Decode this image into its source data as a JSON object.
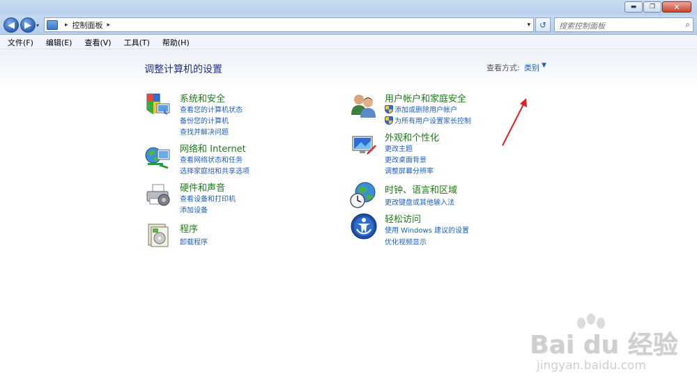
{
  "window": {
    "minimize_glyph": "▬",
    "restore_glyph": "❐",
    "close_glyph": "✕"
  },
  "nav": {
    "back_glyph": "◀",
    "forward_glyph": "▶",
    "history_glyph": "▾"
  },
  "address": {
    "sep_glyph": "▸",
    "path": "控制面板",
    "dropdown_glyph": "▾"
  },
  "refresh_glyph": "↺",
  "search": {
    "placeholder": "搜索控制面板",
    "icon": "search-icon"
  },
  "menu": {
    "items": [
      "文件(F)",
      "编辑(E)",
      "查看(V)",
      "工具(T)",
      "帮助(H)"
    ]
  },
  "page": {
    "title": "调整计算机的设置",
    "view_label": "查看方式:",
    "view_value": "类别",
    "view_arrow": "▼"
  },
  "categories": [
    {
      "title": "系统和安全",
      "icon": "system-security-icon",
      "links": [
        "查看您的计算机状态",
        "备份您的计算机",
        "查找并解决问题"
      ]
    },
    {
      "title": "网络和 Internet",
      "icon": "network-icon",
      "links": [
        "查看网络状态和任务",
        "选择家庭组和共享选项"
      ]
    },
    {
      "title": "硬件和声音",
      "icon": "printer-icon",
      "links": [
        "查看设备和打印机",
        "添加设备"
      ]
    },
    {
      "title": "程序",
      "icon": "programs-icon",
      "links": [
        "卸载程序"
      ]
    },
    {
      "title": "用户帐户和家庭安全",
      "icon": "users-icon",
      "links": [
        "添加或删除用户帐户",
        "为所有用户设置家长控制"
      ]
    },
    {
      "title": "外观和个性化",
      "icon": "appearance-icon",
      "links": [
        "更改主题",
        "更改桌面背景",
        "调整屏幕分辨率"
      ]
    },
    {
      "title": "时钟、语言和区域",
      "icon": "clock-globe-icon",
      "links": [
        "更改键盘或其他输入法"
      ]
    },
    {
      "title": "轻松访问",
      "icon": "ease-of-access-icon",
      "links": [
        "使用 Windows 建议的设置",
        "优化视频显示"
      ]
    }
  ],
  "watermark": {
    "main": "Bai du 经验",
    "url": "jingyan.baidu.com"
  },
  "colors": {
    "link": "#1c5fc9",
    "category_title": "#1f7a1a",
    "page_title": "#1e3287",
    "annotation_arrow": "#e02020"
  }
}
